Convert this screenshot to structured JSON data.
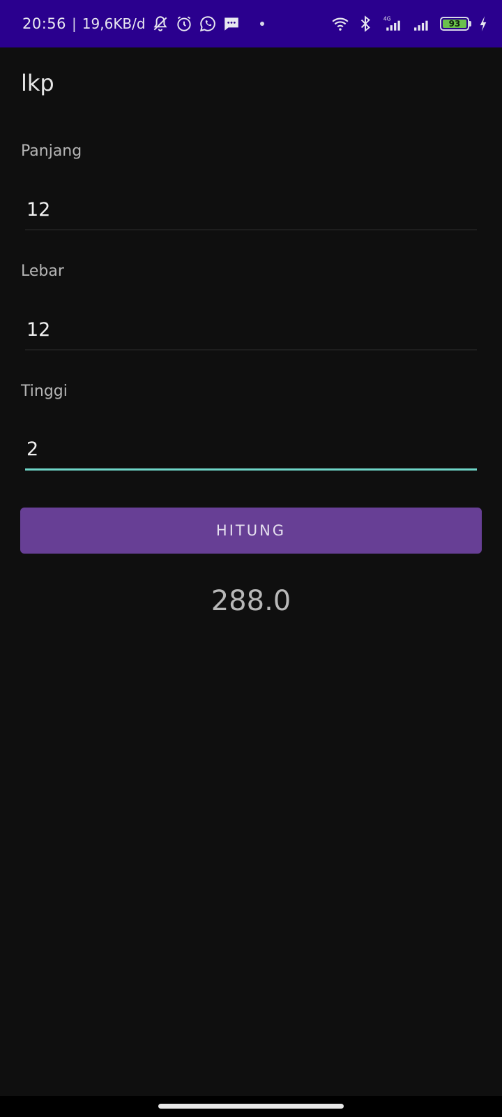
{
  "status_bar": {
    "time": "20:56",
    "separator": "|",
    "net_speed": "19,6KB/d",
    "network_type": "4G",
    "battery_level": "93",
    "colors": {
      "background": "#2a008e",
      "battery_fill": "#6ac04c"
    },
    "icons": [
      "notifications-off-icon",
      "alarm-icon",
      "whatsapp-icon",
      "message-icon",
      "wifi-icon",
      "bluetooth-icon",
      "signal-icon",
      "signal-icon",
      "battery-icon",
      "charging-icon"
    ]
  },
  "app": {
    "title": "lkp"
  },
  "form": {
    "panjang": {
      "label": "Panjang",
      "value": "12"
    },
    "lebar": {
      "label": "Lebar",
      "value": "12"
    },
    "tinggi": {
      "label": "Tinggi",
      "value": "2"
    },
    "button_label": "HITUNG",
    "result": "288.0"
  },
  "colors": {
    "background": "#0f0f0f",
    "button": "#673f95",
    "focus_underline": "#6fd6c8"
  }
}
